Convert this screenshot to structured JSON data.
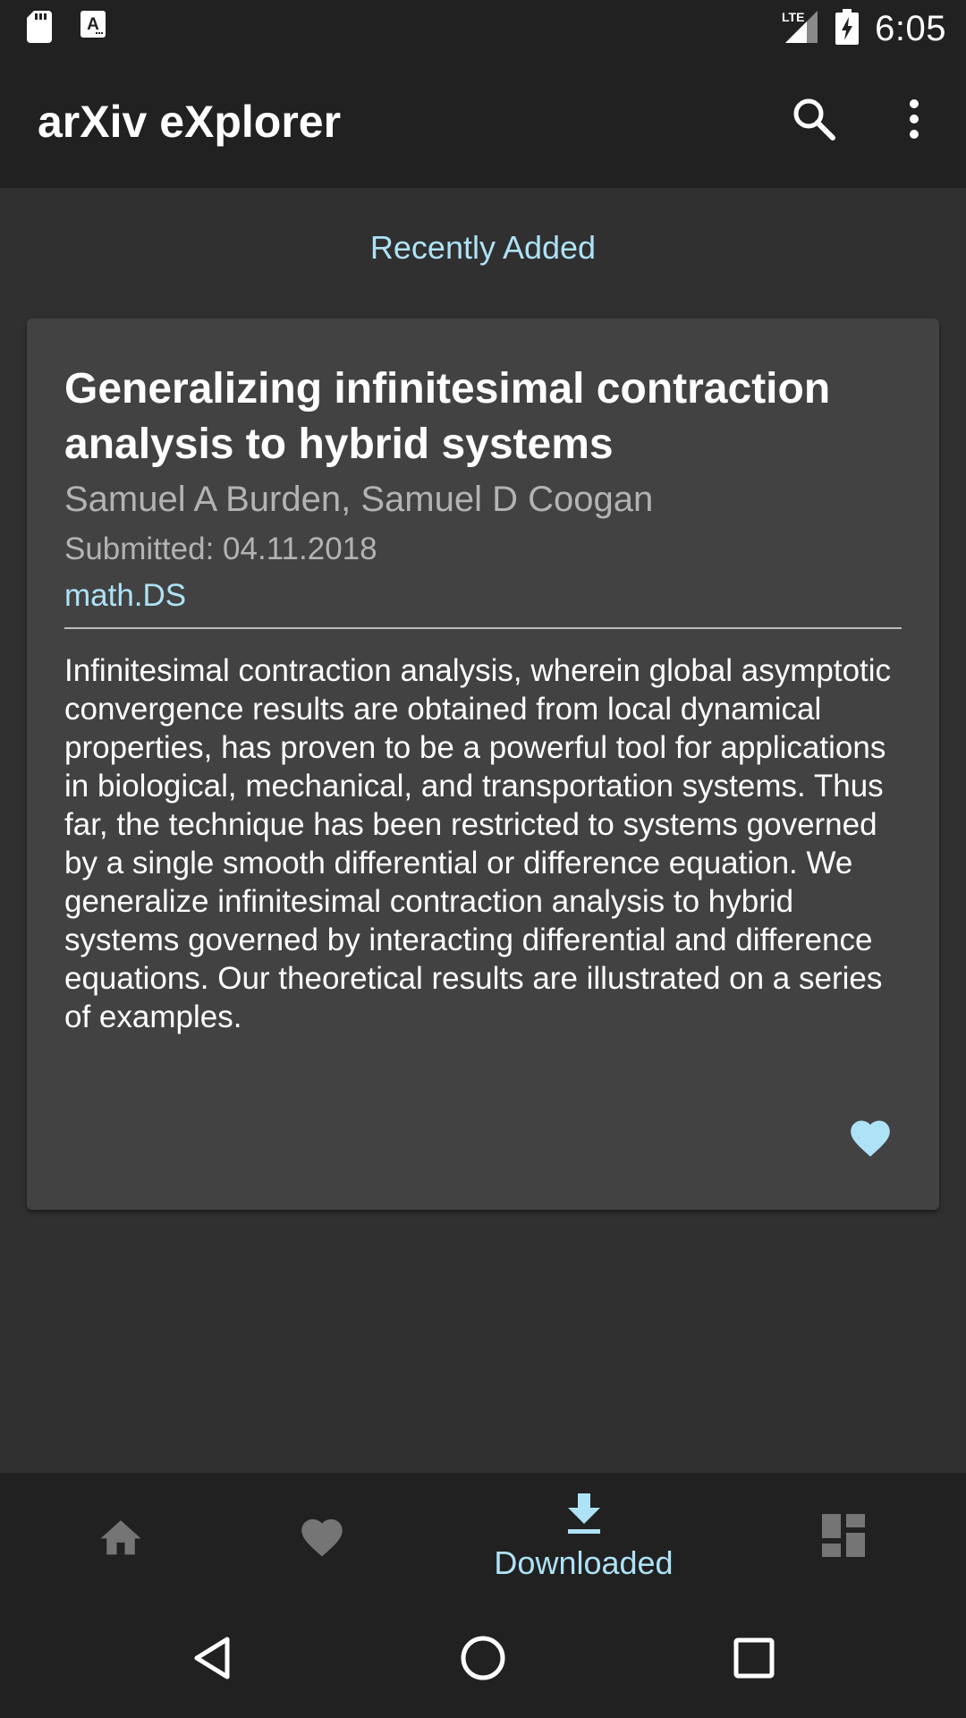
{
  "status_bar": {
    "time": "6:05",
    "network": "LTE",
    "icons": [
      "sd-card-icon",
      "app-notification-icon",
      "lte-signal-icon",
      "battery-charging-icon"
    ]
  },
  "app_bar": {
    "title": "arXiv eXplorer",
    "icons": [
      "search-icon",
      "more-vert-icon"
    ]
  },
  "section": {
    "title": "Recently Added"
  },
  "paper": {
    "title": "Generalizing infinitesimal contraction analysis to hybrid systems",
    "authors": "Samuel A Burden, Samuel D Coogan",
    "submitted": "Submitted: 04.11.2018",
    "category": "math.DS",
    "abstract": "Infinitesimal contraction analysis, wherein global asymptotic convergence results are obtained from local dynamical properties, has proven to be a powerful tool for applications in biological, mechanical, and transportation systems. Thus far, the technique has been restricted to systems governed by a single smooth differential or difference equation. We generalize infinitesimal contraction analysis to hybrid systems governed by interacting differential and difference equations. Our theoretical results are illustrated on a series of examples.",
    "favorite_icon": "heart-icon",
    "favorited": true
  },
  "bottom_nav": {
    "items": [
      {
        "id": "home",
        "icon": "home-icon",
        "label": "",
        "active": false
      },
      {
        "id": "favorites",
        "icon": "heart-icon",
        "label": "",
        "active": false
      },
      {
        "id": "downloaded",
        "icon": "download-icon",
        "label": "Downloaded",
        "active": true
      },
      {
        "id": "dashboard",
        "icon": "dashboard-icon",
        "label": "",
        "active": false
      }
    ]
  },
  "colors": {
    "accent": "#aee2f7",
    "bar_background": "#212121",
    "page_background": "#303030",
    "card_background": "#424242",
    "inactive_icon": "#757575",
    "secondary_text": "#b3b3b3"
  }
}
